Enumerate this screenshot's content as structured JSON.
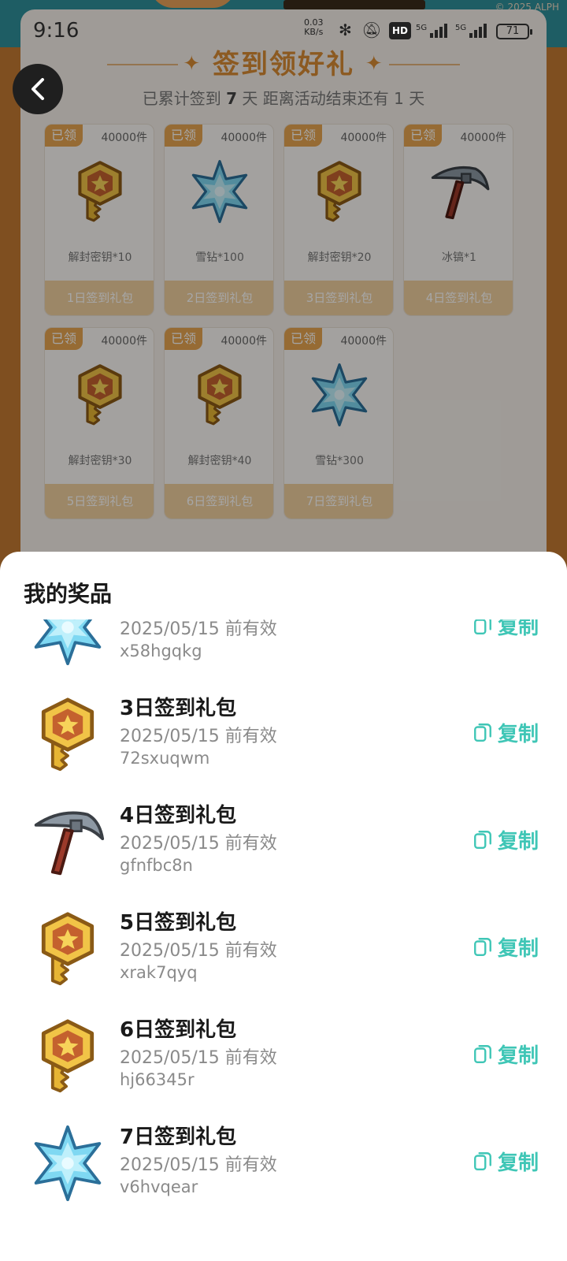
{
  "status_bar": {
    "time": "9:16",
    "net_speed": "0.03",
    "net_unit": "KB/s",
    "hd_label": "HD",
    "signal_1": "5G",
    "signal_2": "5G",
    "battery": "71"
  },
  "background": {
    "copyright": "© 2025 ALPH",
    "title": "签到领好礼",
    "subtitle_prefix": "已累计签到",
    "days_signed": "7",
    "subtitle_mid": "天  距离活动结束还有",
    "days_left": "1",
    "subtitle_suffix": "天",
    "gifts": [
      {
        "claimed": "已领",
        "qty": "40000件",
        "name": "解封密钥*10",
        "pack": "1日签到礼包",
        "icon": "key-icon"
      },
      {
        "claimed": "已领",
        "qty": "40000件",
        "name": "雪钻*100",
        "pack": "2日签到礼包",
        "icon": "snow-diamond-icon"
      },
      {
        "claimed": "已领",
        "qty": "40000件",
        "name": "解封密钥*20",
        "pack": "3日签到礼包",
        "icon": "key-icon"
      },
      {
        "claimed": "已领",
        "qty": "40000件",
        "name": "冰镐*1",
        "pack": "4日签到礼包",
        "icon": "pickaxe-icon"
      },
      {
        "claimed": "已领",
        "qty": "40000件",
        "name": "解封密钥*30",
        "pack": "5日签到礼包",
        "icon": "key-icon"
      },
      {
        "claimed": "已领",
        "qty": "40000件",
        "name": "解封密钥*40",
        "pack": "6日签到礼包",
        "icon": "key-icon"
      },
      {
        "claimed": "已领",
        "qty": "40000件",
        "name": "雪钻*300",
        "pack": "7日签到礼包",
        "icon": "snow-diamond-icon"
      }
    ]
  },
  "sheet": {
    "title": "我的奖品",
    "copy_label": "复制",
    "items": [
      {
        "title": "",
        "expiry": "2025/05/15 前有效",
        "code": "x58hgqkg",
        "icon": "snow-diamond-icon"
      },
      {
        "title": "3日签到礼包",
        "expiry": "2025/05/15 前有效",
        "code": "72sxuqwm",
        "icon": "key-icon"
      },
      {
        "title": "4日签到礼包",
        "expiry": "2025/05/15 前有效",
        "code": "gfnfbc8n",
        "icon": "pickaxe-icon"
      },
      {
        "title": "5日签到礼包",
        "expiry": "2025/05/15 前有效",
        "code": "xrak7qyq",
        "icon": "key-icon"
      },
      {
        "title": "6日签到礼包",
        "expiry": "2025/05/15 前有效",
        "code": "hj66345r",
        "icon": "key-icon"
      },
      {
        "title": "7日签到礼包",
        "expiry": "2025/05/15 前有效",
        "code": "v6hvqear",
        "icon": "snow-diamond-icon"
      }
    ]
  },
  "colors": {
    "accent_teal": "#3fc6b6",
    "gold": "#e6a550"
  }
}
